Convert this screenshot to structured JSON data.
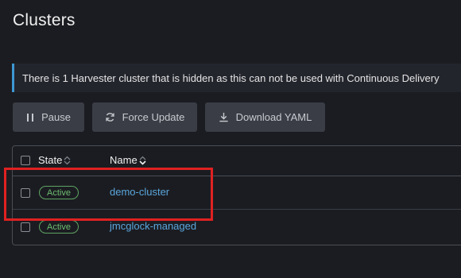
{
  "page": {
    "title": "Clusters"
  },
  "banner": {
    "text": "There is 1 Harvester cluster that is hidden as this can not be used with Continuous Delivery"
  },
  "toolbar": {
    "pause_label": "Pause",
    "pause_icon": "pause-icon",
    "force_update_label": "Force Update",
    "force_update_icon": "refresh-icon",
    "download_label": "Download YAML",
    "download_icon": "download-icon"
  },
  "table": {
    "columns": {
      "state": "State",
      "name": "Name"
    },
    "rows": [
      {
        "state": "Active",
        "name": "demo-cluster"
      },
      {
        "state": "Active",
        "name": "jmcglock-managed"
      }
    ]
  },
  "colors": {
    "background": "#1b1c21",
    "accent": "#3d98d3",
    "link": "#5aa6dc",
    "active_badge": "#6dbc70",
    "highlight": "#e02121"
  }
}
